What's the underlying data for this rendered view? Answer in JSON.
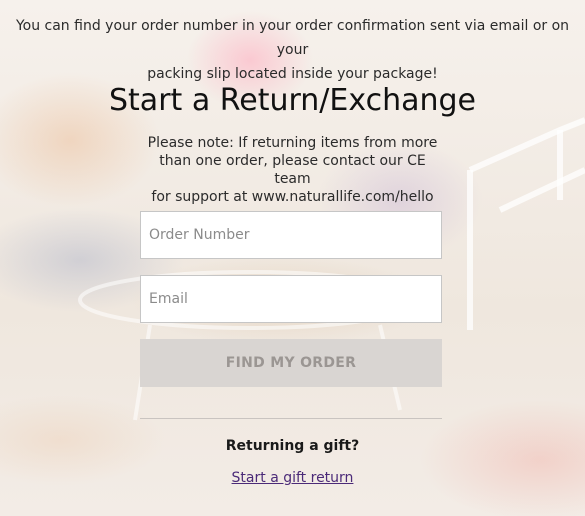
{
  "intro": {
    "line1": "You can find your order number in your order confirmation sent via email or on your",
    "line2": "packing slip located inside your package!"
  },
  "title": "Start a Return/Exchange",
  "note": {
    "line1": "Please note: If returning items from more",
    "line2": "than one order, please contact our CE team",
    "line3": "for support at www.naturallife.com/hello"
  },
  "form": {
    "order_number": {
      "value": "",
      "placeholder": "Order Number"
    },
    "email": {
      "value": "",
      "placeholder": "Email"
    },
    "find_button_label": "FIND MY ORDER"
  },
  "gift": {
    "question": "Returning a gift?",
    "link_label": "Start a gift return"
  },
  "colors": {
    "link": "#4b2a78",
    "button_bg": "#d9d5d2",
    "button_text": "#9b9693"
  }
}
